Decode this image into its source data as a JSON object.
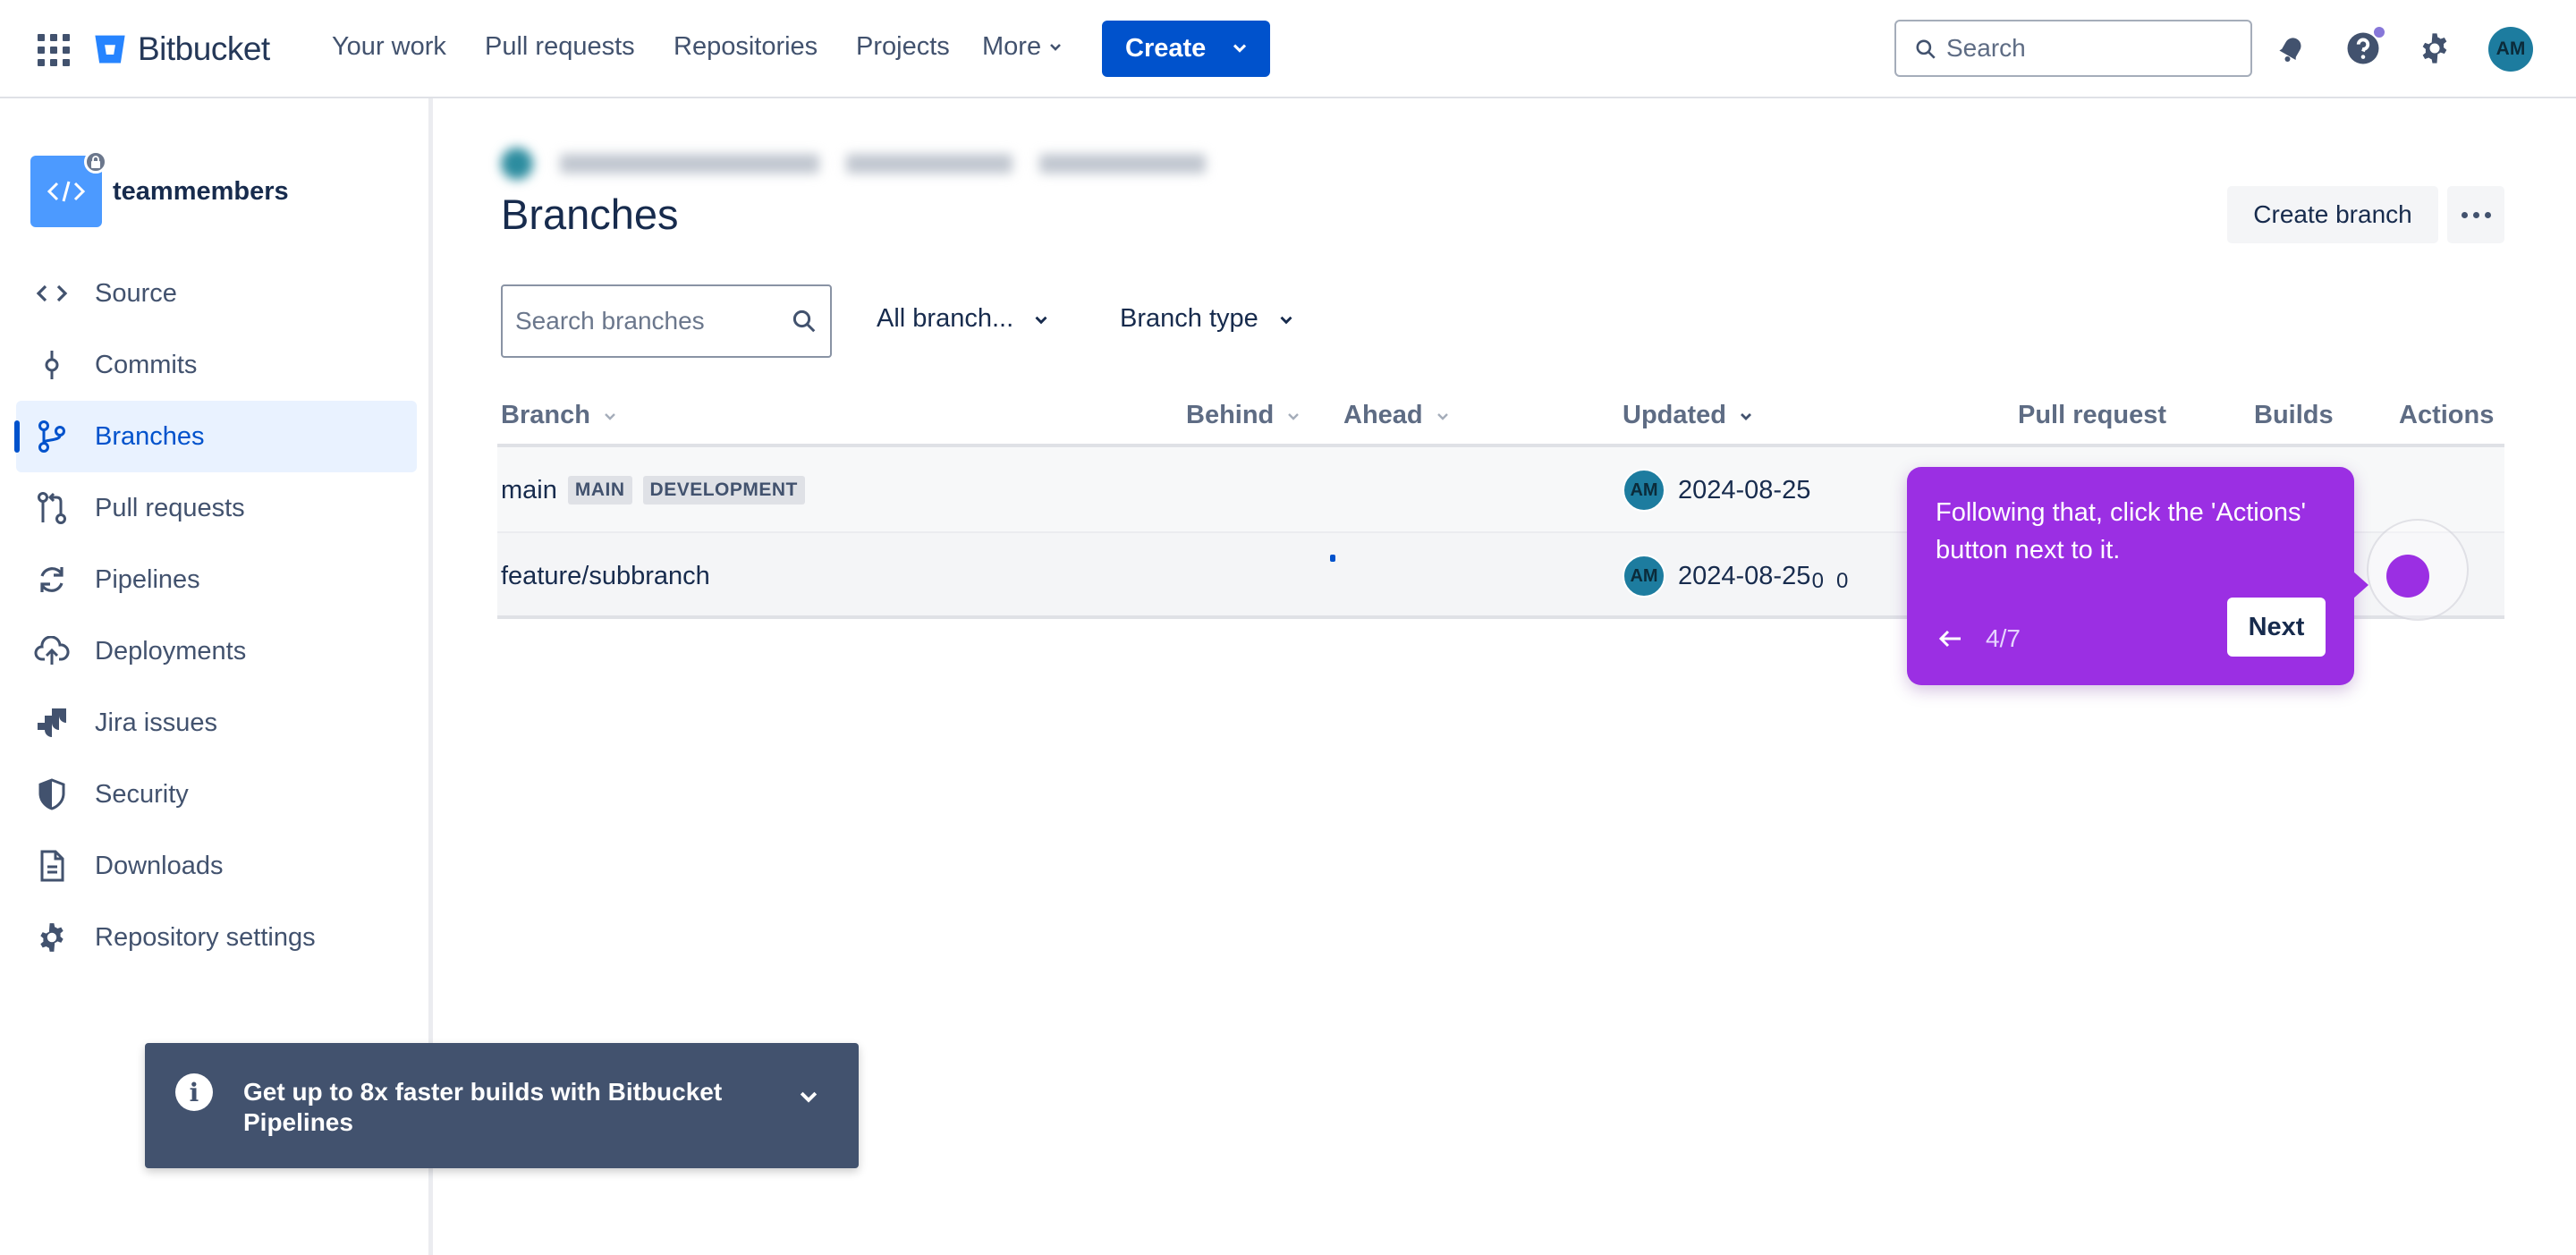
{
  "topnav": {
    "brand": "Bitbucket",
    "items": [
      "Your work",
      "Pull requests",
      "Repositories",
      "Projects",
      "More"
    ],
    "create_label": "Create",
    "search_placeholder": "Search",
    "avatar_initials": "AM"
  },
  "sidebar": {
    "repo_name": "teammembers",
    "items": [
      {
        "label": "Source",
        "icon": "code-icon"
      },
      {
        "label": "Commits",
        "icon": "commit-icon"
      },
      {
        "label": "Branches",
        "icon": "branch-icon",
        "active": true
      },
      {
        "label": "Pull requests",
        "icon": "pull-request-icon"
      },
      {
        "label": "Pipelines",
        "icon": "pipelines-icon"
      },
      {
        "label": "Deployments",
        "icon": "cloud-upload-icon"
      },
      {
        "label": "Jira issues",
        "icon": "jira-icon"
      },
      {
        "label": "Security",
        "icon": "shield-icon"
      },
      {
        "label": "Downloads",
        "icon": "document-icon"
      },
      {
        "label": "Repository settings",
        "icon": "gear-icon"
      }
    ]
  },
  "main": {
    "title": "Branches",
    "create_branch_label": "Create branch",
    "search_placeholder": "Search branches",
    "filter_all": "All branch...",
    "filter_type": "Branch type",
    "columns": {
      "branch": "Branch",
      "behind": "Behind",
      "ahead": "Ahead",
      "updated": "Updated",
      "pull_request": "Pull request",
      "builds": "Builds",
      "actions": "Actions"
    },
    "rows": [
      {
        "name": "main",
        "badges": [
          "MAIN",
          "DEVELOPMENT"
        ],
        "behind": "",
        "ahead": "",
        "avatar": "AM",
        "updated": "2024-08-25"
      },
      {
        "name": "feature/subbranch",
        "badges": [],
        "behind": "0",
        "ahead": "0",
        "avatar": "AM",
        "updated": "2024-08-25"
      }
    ]
  },
  "guide": {
    "text": "Following that, click the 'Actions' button next to it.",
    "step": "4/7",
    "next_label": "Next"
  },
  "flag": {
    "text": "Get up to 8x faster builds with Bitbucket Pipelines"
  },
  "colors": {
    "primary": "#0052cc",
    "guide": "#9b2fe3",
    "flag": "#42526e"
  }
}
